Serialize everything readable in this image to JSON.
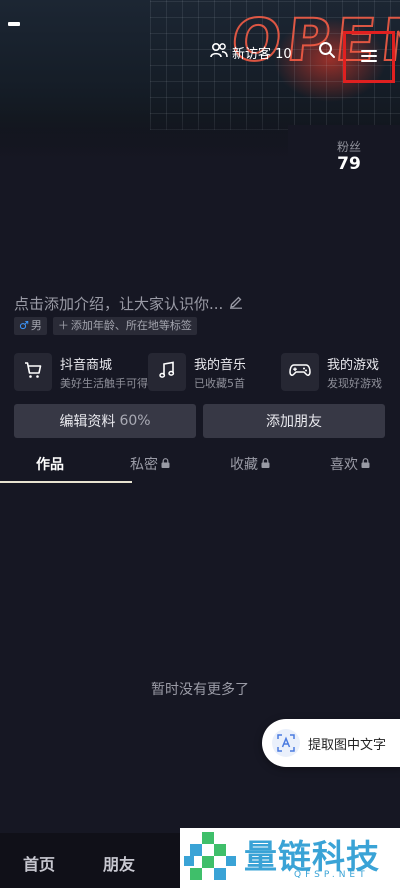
{
  "header": {
    "visitors_label": "新访客 10",
    "fans_label": "粉丝",
    "fans_count": "79"
  },
  "profile": {
    "intro": "点击添加介绍，让大家认识你...",
    "gender_tag": "男",
    "add_tags_label": "添加年龄、所在地等标签"
  },
  "services": [
    {
      "title": "抖音商城",
      "subtitle": "美好生活触手可得",
      "icon": "cart-icon"
    },
    {
      "title": "我的音乐",
      "subtitle": "已收藏5首",
      "icon": "music-icon"
    },
    {
      "title": "我的游戏",
      "subtitle": "发现好游戏",
      "icon": "gamepad-icon"
    }
  ],
  "actions": {
    "edit_label": "编辑资料",
    "edit_progress": "60%",
    "add_friend_label": "添加朋友"
  },
  "tabs": [
    {
      "label": "作品",
      "locked": false,
      "active": true
    },
    {
      "label": "私密",
      "locked": true,
      "active": false
    },
    {
      "label": "收藏",
      "locked": true,
      "active": false
    },
    {
      "label": "喜欢",
      "locked": true,
      "active": false
    }
  ],
  "empty_message": "暂时没有更多了",
  "ocr_button_label": "提取图中文字",
  "bottom_nav": {
    "home": "首页",
    "friends": "朋友"
  },
  "watermark": {
    "text": "量链科技",
    "sub": "QFSP.NET"
  },
  "colors": {
    "background": "#161723",
    "highlight_box": "#e02020",
    "watermark": "#3aa3d6"
  }
}
